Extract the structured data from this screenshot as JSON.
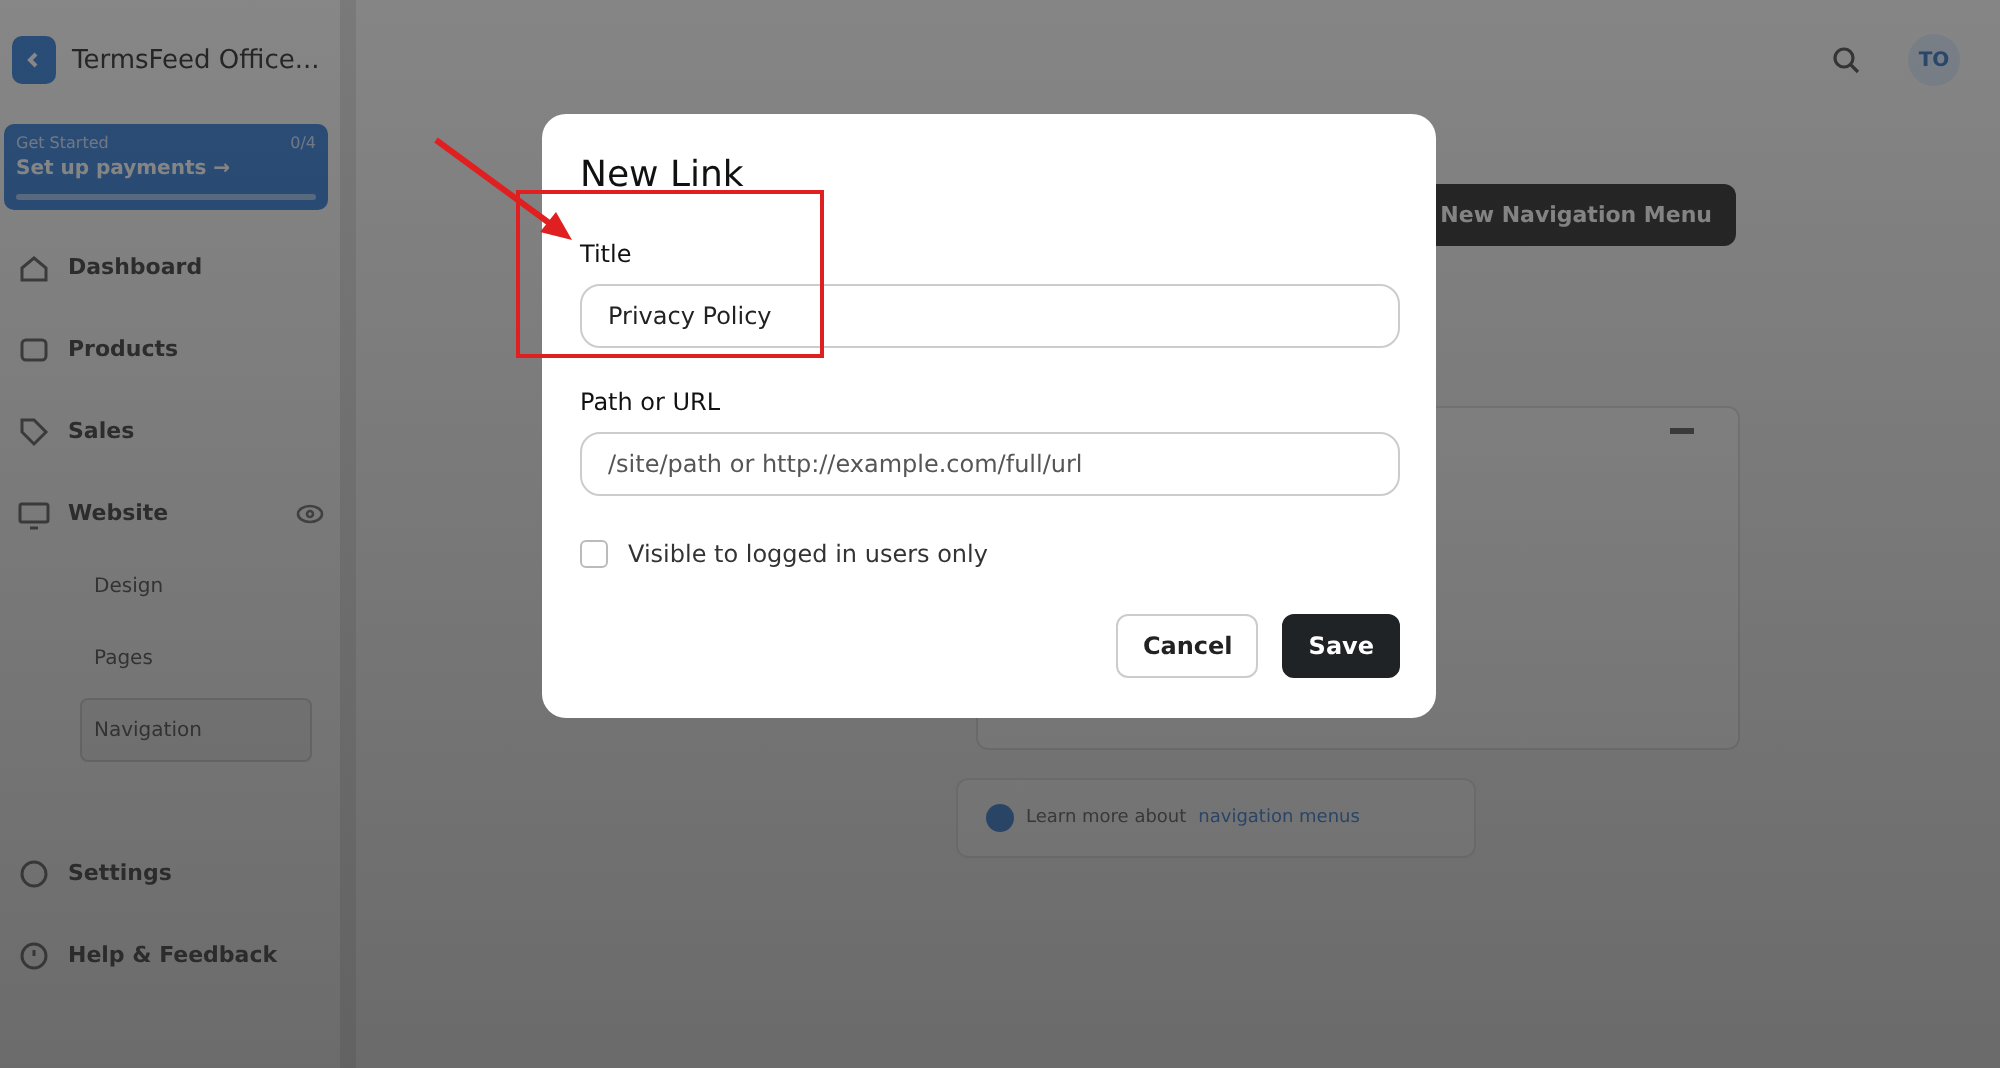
{
  "app": {
    "title": "TermsFeed Office...",
    "avatar": "TO"
  },
  "setup_card": {
    "label": "Get Started",
    "count": "0/4",
    "title": "Set up payments →"
  },
  "sidebar": {
    "items": [
      {
        "label": "Dashboard",
        "expanded": false
      },
      {
        "label": "Products",
        "expanded": false
      },
      {
        "label": "Sales",
        "expanded": false
      },
      {
        "label": "Website",
        "expanded": true,
        "children": [
          {
            "label": "Design",
            "selected": false
          },
          {
            "label": "Pages",
            "selected": false
          },
          {
            "label": "Navigation",
            "selected": true
          }
        ]
      }
    ],
    "footer_items": [
      {
        "label": "Settings"
      },
      {
        "label": "Help & Feedback"
      }
    ]
  },
  "main": {
    "new_menu_button": "New Navigation Menu",
    "learn_more_text": "Learn more about",
    "learn_more_link": "navigation menus"
  },
  "dialog": {
    "title": "New Link",
    "fields": [
      {
        "label": "Title",
        "value": "Privacy Policy",
        "highlighted": true
      },
      {
        "label": "Path or URL",
        "placeholder": "/site/path or http://example.com/full/url",
        "highlighted": false
      }
    ],
    "checkbox": {
      "label": "Visible to logged in users only",
      "checked": false
    },
    "buttons": [
      {
        "label": "Cancel",
        "kind": "secondary"
      },
      {
        "label": "Save",
        "kind": "primary"
      }
    ]
  }
}
